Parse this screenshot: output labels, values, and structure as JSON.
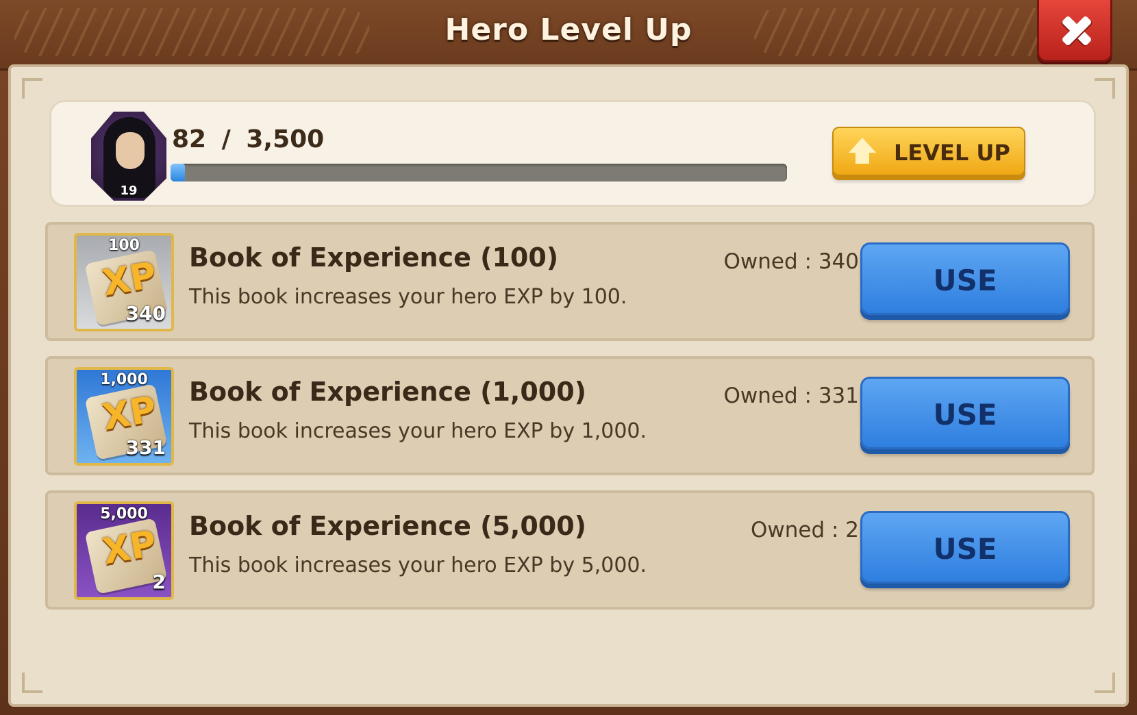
{
  "dialog": {
    "title": "Hero Level Up"
  },
  "hero": {
    "level": "19",
    "exp_current": "82",
    "exp_separator": "/",
    "exp_max": "3,500",
    "exp_progress_percent": 2.3,
    "level_up_label": "LEVEL UP"
  },
  "items": [
    {
      "icon_top": "100",
      "icon_count": "340",
      "name": "Book of Experience (100)",
      "description": "This book increases your hero EXP by 100.",
      "owned": "Owned : 340",
      "button": "USE",
      "tier_color": "#a8abb0"
    },
    {
      "icon_top": "1,000",
      "icon_count": "331",
      "name": "Book of Experience (1,000)",
      "description": "This book increases your hero EXP by 1,000.",
      "owned": "Owned : 331",
      "button": "USE",
      "tier_color": "#2f78d6"
    },
    {
      "icon_top": "5,000",
      "icon_count": "2",
      "name": "Book of Experience (5,000)",
      "description": "This book increases your hero EXP by 5,000.",
      "owned": "Owned : 2",
      "button": "USE",
      "tier_color": "#5a2c8e"
    }
  ],
  "icons": {
    "xp_label": "XP",
    "close": "close-icon",
    "level_up": "arrow-up-icon"
  },
  "colors": {
    "frame": "#6a3a1e",
    "panel": "#eadfcb",
    "level_up_button": "#f0a814",
    "use_button": "#2f7fe0",
    "close_button": "#d2332a"
  }
}
